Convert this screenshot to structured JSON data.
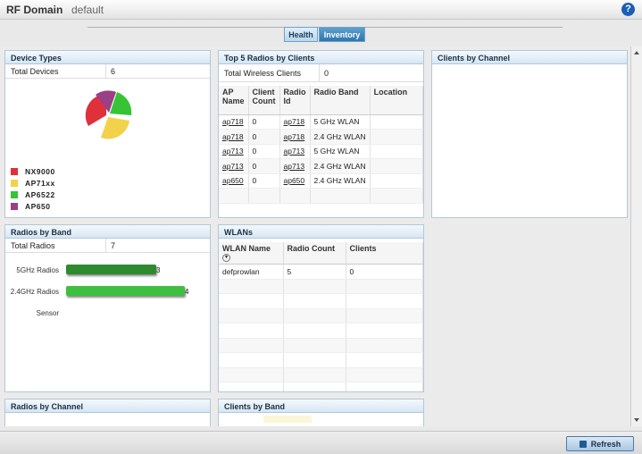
{
  "header": {
    "title": "RF Domain",
    "subtitle": "default",
    "help_icon": "?"
  },
  "tabs": [
    {
      "label": "Health"
    },
    {
      "label": "Inventory"
    }
  ],
  "device_types": {
    "title": "Device Types",
    "total_label": "Total Devices",
    "total_value": "6",
    "legend": [
      {
        "label": "NX9000",
        "color": "#e0303a"
      },
      {
        "label": "AP71xx",
        "color": "#f2d24a"
      },
      {
        "label": "AP6522",
        "color": "#36c336"
      },
      {
        "label": "AP650",
        "color": "#9b3f86"
      }
    ]
  },
  "top5": {
    "title": "Top 5 Radios by Clients",
    "total_label": "Total Wireless Clients",
    "total_value": "0",
    "columns": [
      "AP Name",
      "Client Count",
      "Radio Id",
      "Radio Band",
      "Location"
    ],
    "rows": [
      {
        "ap": "ap718",
        "count": "0",
        "radio": "ap718",
        "band": "5 GHz WLAN",
        "loc": ""
      },
      {
        "ap": "ap718",
        "count": "0",
        "radio": "ap718",
        "band": "2.4 GHz WLAN",
        "loc": ""
      },
      {
        "ap": "ap713",
        "count": "0",
        "radio": "ap713",
        "band": "5 GHz WLAN",
        "loc": ""
      },
      {
        "ap": "ap713",
        "count": "0",
        "radio": "ap713",
        "band": "2.4 GHz WLAN",
        "loc": ""
      },
      {
        "ap": "ap650",
        "count": "0",
        "radio": "ap650",
        "band": "2.4 GHz WLAN",
        "loc": ""
      }
    ]
  },
  "clients_by_channel": {
    "title": "Clients by Channel"
  },
  "radios_by_band": {
    "title": "Radios by Band",
    "total_label": "Total Radios",
    "total_value": "7",
    "bars": [
      {
        "label": "5GHz Radios",
        "value": 3,
        "color": "#2e8a2e"
      },
      {
        "label": "2.4GHz Radios",
        "value": 4,
        "color": "#3fbf3f"
      },
      {
        "label": "Sensor",
        "value": 0,
        "color": "#3fbf3f"
      }
    ],
    "bar_value_texts": [
      "3",
      "4"
    ]
  },
  "wlans": {
    "title": "WLANs",
    "columns": [
      "WLAN Name",
      "Radio Count",
      "Clients"
    ],
    "rows": [
      {
        "name": "defprowlan",
        "radio_count": "5",
        "clients": "0"
      }
    ]
  },
  "radios_by_channel": {
    "title": "Radios by Channel"
  },
  "clients_by_band": {
    "title": "Clients by Band"
  },
  "footer": {
    "refresh_label": "Refresh"
  }
}
